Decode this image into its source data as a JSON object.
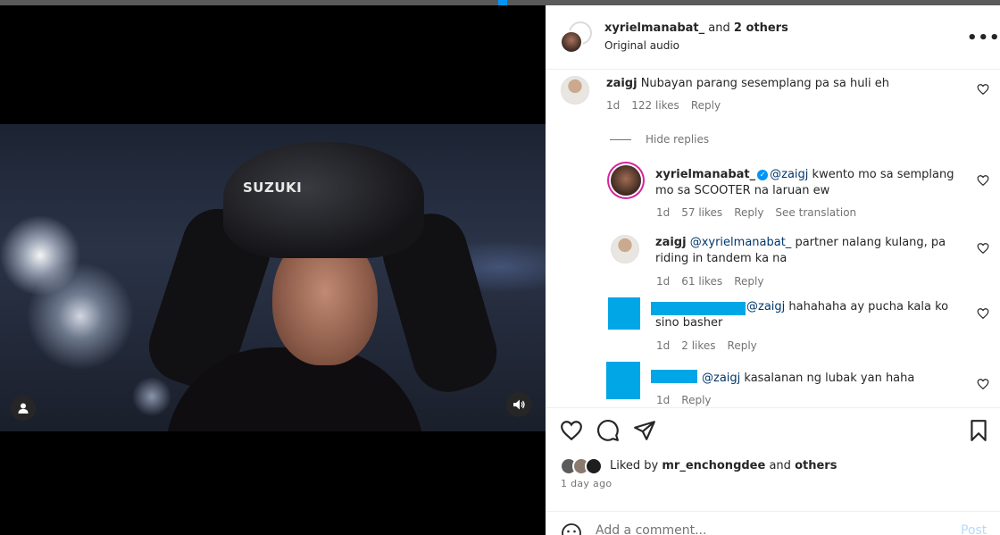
{
  "colors": {
    "accent": "#0095f6",
    "mention": "#00376b",
    "muted": "#737373",
    "story_ring": "#d6249f",
    "redaction": "#00a6e6"
  },
  "media": {
    "helmet_text": "SUZUKI",
    "user_icon": "user-icon",
    "sound_icon": "speaker-icon"
  },
  "header": {
    "username": "xyrielmanabat_",
    "others_prefix": "and",
    "others": "2 others",
    "audio": "Original audio",
    "more": "•••"
  },
  "comments": [
    {
      "user": "zaigj",
      "text": "Nubayan parang sesemplang pa sa huli eh",
      "time": "1d",
      "likes": "122 likes",
      "reply": "Reply"
    },
    {
      "user": "xyrielmanabat_",
      "verified": true,
      "mention": "@zaigj",
      "text": " kwento mo sa semplang mo sa SCOOTER na laruan ew",
      "time": "1d",
      "likes": "57 likes",
      "reply": "Reply",
      "translate": "See translation"
    },
    {
      "user": "zaigj",
      "mention": "@xyrielmanabat_",
      "text": " partner nalang kulang, pa riding in tandem ka na",
      "time": "1d",
      "likes": "61 likes",
      "reply": "Reply"
    },
    {
      "mention": "@zaigj",
      "text": " hahahaha ay pucha kala ko sino basher",
      "time": "1d",
      "likes": "2 likes",
      "reply": "Reply"
    },
    {
      "mention": "@zaigj",
      "text": " kasalanan ng lubak yan haha",
      "time": "1d",
      "reply": "Reply"
    }
  ],
  "hide_replies": "Hide replies",
  "likes": {
    "prefix": "Liked by",
    "user": "mr_enchongdee",
    "and": "and",
    "others": "others",
    "time": "1 day ago"
  },
  "comment_box": {
    "placeholder": "Add a comment...",
    "post": "Post"
  }
}
